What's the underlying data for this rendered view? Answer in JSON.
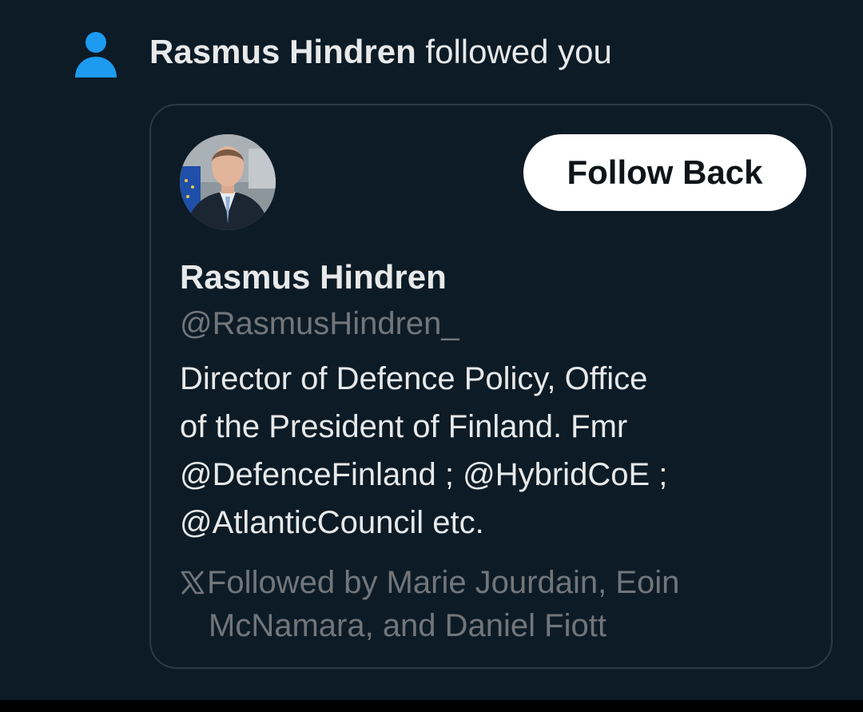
{
  "notification": {
    "icon": "person-icon",
    "actor_name": "Rasmus Hindren",
    "action_text": " followed you",
    "accent_color": "#1d9bf0"
  },
  "profile_card": {
    "avatar": "profile-photo",
    "follow_button_label": "Follow Back",
    "display_name": "Rasmus Hindren",
    "handle": "@RasmusHindren_",
    "bio_lines": [
      "Director of Defence Policy, Office",
      "of the President of Finland. Fmr",
      "@DefenceFinland ; @HybridCoE ;",
      "@AtlanticCouncil etc."
    ],
    "followed_by_icon": "x-logo-icon",
    "followed_by_lines": [
      "Followed by Marie Jourdain, Eoin",
      "McNamara, and Daniel Fiott"
    ]
  },
  "colors": {
    "background": "#0d1b26",
    "primary_text": "#e7e9ea",
    "secondary_text": "#71767b",
    "card_border": "#2b3a44",
    "button_bg": "#ffffff",
    "button_text": "#0f1419"
  }
}
